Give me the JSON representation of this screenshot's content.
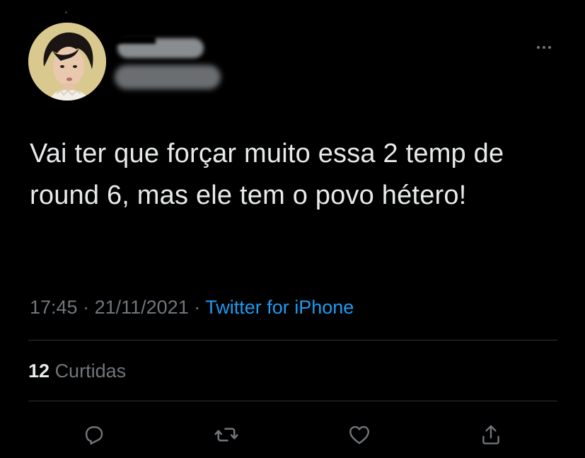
{
  "tweet": {
    "author": {
      "name": "",
      "handle": "",
      "avatar_icon": "avatar-photo"
    },
    "text": "Vai ter que forçar muito essa 2 temp de round 6, mas ele tem o povo hétero!",
    "time": "17:45",
    "separator": " · ",
    "date": "21/11/2021",
    "source": "Twitter for iPhone",
    "likes_count": "12",
    "likes_label": "Curtidas"
  },
  "actions": [
    {
      "icon": "reply-icon"
    },
    {
      "icon": "retweet-icon"
    },
    {
      "icon": "like-icon"
    },
    {
      "icon": "share-icon"
    }
  ],
  "colors": {
    "background": "#000000",
    "text": "#e7e9ea",
    "secondary": "#71767b",
    "link": "#1d9bf0",
    "divider": "#2f3336"
  }
}
